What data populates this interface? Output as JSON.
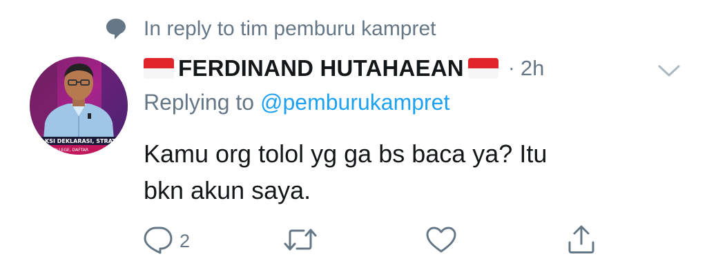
{
  "context": {
    "icon": "speech-bubble-icon",
    "text": "In reply to tim pemburu kampret"
  },
  "tweet": {
    "display_name": "FERDINAND HUTAHAEAN",
    "time": "2h",
    "separator": "·",
    "replying_prefix": "Replying to ",
    "replying_handle": "@pemburukampret",
    "text_line1": "Kamu org tolol yg ga bs baca ya? Itu",
    "text_line2": "bkn akun saya.",
    "avatar_caption_line1": "KSI DEKLARASI, STRAT",
    "avatar_caption_line2": "COLLEGE, DAFTAR"
  },
  "actions": {
    "reply_count": "2",
    "icons": [
      "reply-icon",
      "retweet-icon",
      "like-icon",
      "share-icon"
    ]
  },
  "colors": {
    "text": "#14171a",
    "secondary": "#657786",
    "link": "#1da1f2",
    "flag_red": "#e0262b",
    "flag_white": "#f6f6f6"
  }
}
